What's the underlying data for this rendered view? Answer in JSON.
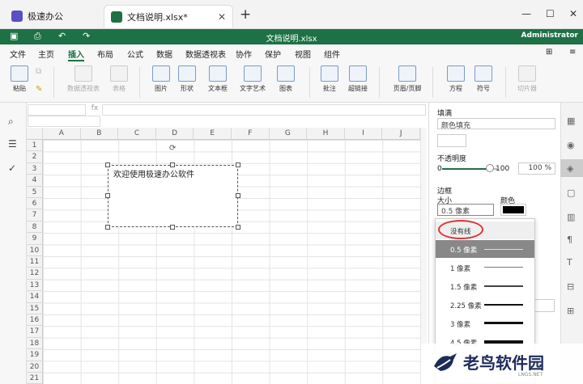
{
  "titlebar": {
    "home_tab": "极速办公",
    "doc_tab": "文档说明.xlsx*",
    "new_tab": "+",
    "home_icon_color": "#5b4fc5",
    "doc_icon_color": "#1e7145"
  },
  "quickbar": {
    "doc_name": "文档说明.xlsx",
    "user": "Administrator",
    "accent": "#1e7145"
  },
  "menu": [
    "文件",
    "主页",
    "插入",
    "布局",
    "公式",
    "数据",
    "数据透视表",
    "协作",
    "保护",
    "视图",
    "组件"
  ],
  "menu_active": "插入",
  "ribbon": {
    "paste": "粘贴",
    "pivot": "数据透视表",
    "table": "表格",
    "image": "图片",
    "shape": "形状",
    "textbox": "文本框",
    "textart": "文字艺术",
    "chart": "图表",
    "comment": "批注",
    "hyperlink": "超链接",
    "header_footer": "页眉/页脚",
    "equation": "方程",
    "symbol": "符号",
    "slicer": "切片器"
  },
  "formula": {
    "fx": "fx"
  },
  "grid": {
    "columns": [
      "A",
      "B",
      "C",
      "D",
      "E",
      "F",
      "G",
      "H",
      "I",
      "J"
    ],
    "rows": [
      "1",
      "2",
      "3",
      "4",
      "5",
      "6",
      "7",
      "8",
      "9",
      "10",
      "11",
      "12",
      "13",
      "14",
      "15",
      "16",
      "17",
      "18",
      "19",
      "20",
      "21"
    ]
  },
  "textbox": {
    "content": "欢迎使用极速办公软件"
  },
  "panel": {
    "fill_label": "填满",
    "fill_value": "颜色填充",
    "opacity_label": "不透明度",
    "opacity_min": "0",
    "opacity_max": "100",
    "opacity_value": "100 %",
    "opacity_level": 1.0,
    "border_label": "边框",
    "size_label": "大小",
    "color_label": "颜色",
    "size_value": "0.5 像素",
    "border_color": "#000000"
  },
  "dropdown": {
    "none": "没有线",
    "items": [
      "0.5 像素",
      "1 像素",
      "1.5 像素",
      "2.25 像素",
      "3 像素",
      "4.5 像素"
    ],
    "selected": "0.5 像素"
  },
  "watermark": {
    "title": "老鸟软件园",
    "sub": "LNGS.NET"
  }
}
